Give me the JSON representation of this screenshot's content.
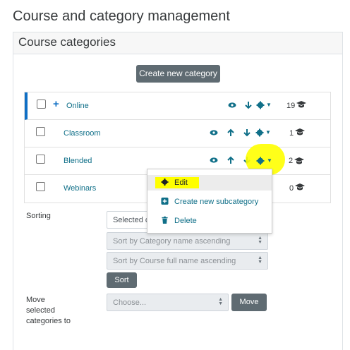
{
  "page": {
    "title": "Course and category management"
  },
  "panel": {
    "header": "Course categories",
    "create_button": "Create new category"
  },
  "categories": [
    {
      "name": "Online",
      "count": "19",
      "expandable": true,
      "active": true
    },
    {
      "name": "Classroom",
      "count": "1"
    },
    {
      "name": "Blended",
      "count": "2"
    },
    {
      "name": "Webinars",
      "count": "0"
    }
  ],
  "menu": {
    "items": [
      {
        "label": "Edit",
        "icon": "gear-icon"
      },
      {
        "label": "Create new subcategory",
        "icon": "plus-square-icon"
      },
      {
        "label": "Delete",
        "icon": "trash-icon"
      }
    ]
  },
  "sorting": {
    "label": "Sorting",
    "select1_value": "Selected c",
    "select2_value": "Sort by Category name ascending",
    "select3_value": "Sort by Course full name ascending",
    "button": "Sort"
  },
  "move": {
    "label_line1": "Move",
    "label_line2": "selected",
    "label_line3": "categories to",
    "select_value": "Choose...",
    "button": "Move"
  },
  "colors": {
    "accent": "#0f6fc5",
    "link": "#0f6f88",
    "button_dark": "#5f6b72",
    "highlight": "#ffff00"
  }
}
